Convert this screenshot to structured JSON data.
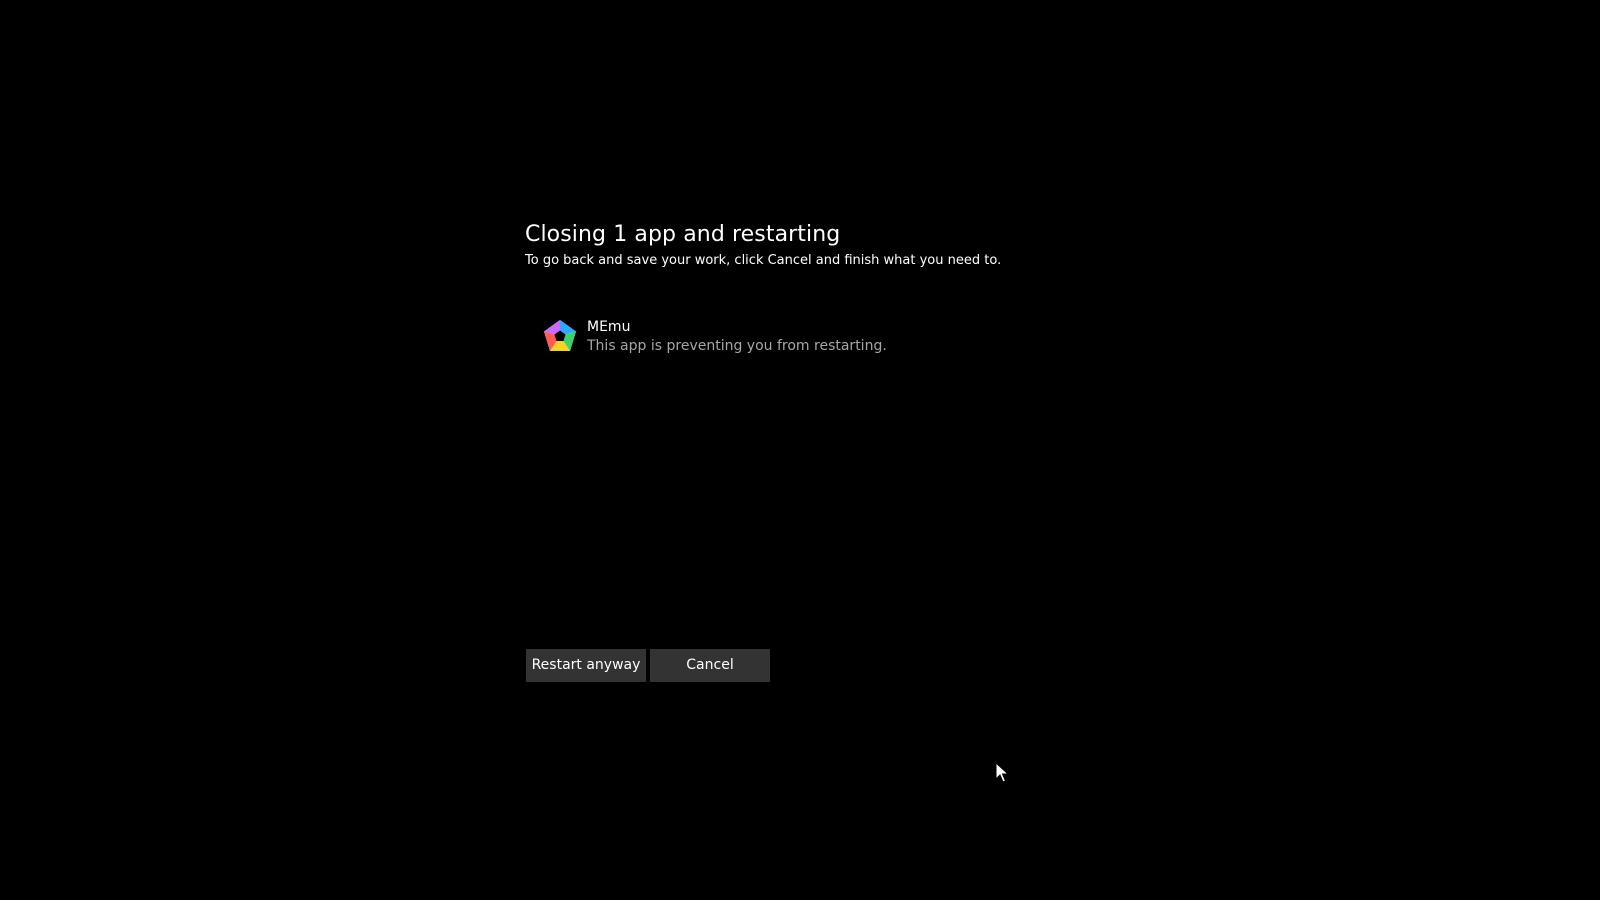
{
  "dialog": {
    "title": "Closing 1 app and restarting",
    "subtitle": "To go back and save your work, click Cancel and finish what you need to."
  },
  "apps": [
    {
      "name": "MEmu",
      "status": "This app is preventing you from restarting.",
      "icon": "memu-app-icon"
    }
  ],
  "buttons": {
    "restart_label": "Restart anyway",
    "cancel_label": "Cancel"
  },
  "colors": {
    "background": "#000000",
    "text": "#ffffff",
    "secondary_text": "#a6a6a6",
    "button_bg": "#333333"
  }
}
